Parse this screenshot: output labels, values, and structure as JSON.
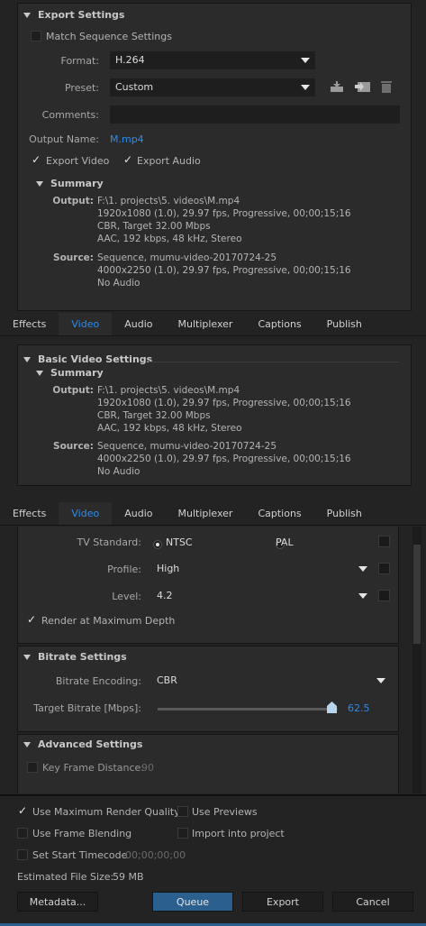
{
  "export_settings": {
    "title": "Export Settings",
    "match_sequence_label": "Match Sequence Settings",
    "format_label": "Format:",
    "format_value": "H.264",
    "preset_label": "Preset:",
    "preset_value": "Custom",
    "comments_label": "Comments:",
    "output_name_label": "Output Name:",
    "output_name_value": "M.mp4",
    "export_video_label": "Export Video",
    "export_audio_label": "Export Audio",
    "summary_title": "Summary",
    "output_key": "Output:",
    "output_lines": [
      "F:\\1. projects\\5. videos\\M.mp4",
      "1920x1080 (1.0), 29.97 fps, Progressive, 00;00;15;16",
      "CBR, Target 32.00 Mbps",
      "AAC, 192 kbps, 48 kHz, Stereo"
    ],
    "source_key": "Source:",
    "source_lines": [
      "Sequence, mumu-video-20170724-25",
      "4000x2250 (1.0), 29.97 fps, Progressive, 00;00;15;16",
      "No Audio"
    ]
  },
  "tabs": [
    "Effects",
    "Video",
    "Audio",
    "Multiplexer",
    "Captions",
    "Publish"
  ],
  "active_tab": "Video",
  "basic_video": {
    "title": "Basic Video Settings",
    "summary_title": "Summary",
    "output_key": "Output:",
    "output_lines": [
      "F:\\1. projects\\5. videos\\M.mp4",
      "1920x1080 (1.0), 29.97 fps, Progressive, 00;00;15;16",
      "CBR, Target 32.00 Mbps",
      "AAC, 192 kbps, 48 kHz, Stereo"
    ],
    "source_key": "Source:",
    "source_lines": [
      "Sequence, mumu-video-20170724-25",
      "4000x2250 (1.0), 29.97 fps, Progressive, 00;00;15;16",
      "No Audio"
    ]
  },
  "video_settings": {
    "tv_standard_label": "TV Standard:",
    "ntsc_label": "NTSC",
    "pal_label": "PAL",
    "profile_label": "Profile:",
    "profile_value": "High",
    "level_label": "Level:",
    "level_value": "4.2",
    "render_max_depth_label": "Render at Maximum Depth"
  },
  "bitrate": {
    "title": "Bitrate Settings",
    "encoding_label": "Bitrate Encoding:",
    "encoding_value": "CBR",
    "target_label": "Target Bitrate [Mbps]:",
    "target_value": "62.5",
    "target_fraction": 0.97
  },
  "advanced": {
    "title": "Advanced Settings",
    "key_frame_label": "Key Frame Distance:",
    "key_frame_value": "90"
  },
  "footer": {
    "use_max_quality_label": "Use Maximum Render Quality",
    "use_previews_label": "Use Previews",
    "use_frame_blending_label": "Use Frame Blending",
    "import_into_project_label": "Import into project",
    "set_start_timecode_label": "Set Start Timecode",
    "start_timecode_value": "00;00;00;00",
    "estimated_size_label": "Estimated File Size:",
    "estimated_size_value": "59 MB",
    "metadata_button": "Metadata...",
    "queue_button": "Queue",
    "export_button": "Export",
    "cancel_button": "Cancel"
  },
  "colors": {
    "accent": "#2d8ceb",
    "panel": "#2b2b2b",
    "background": "#232323"
  }
}
